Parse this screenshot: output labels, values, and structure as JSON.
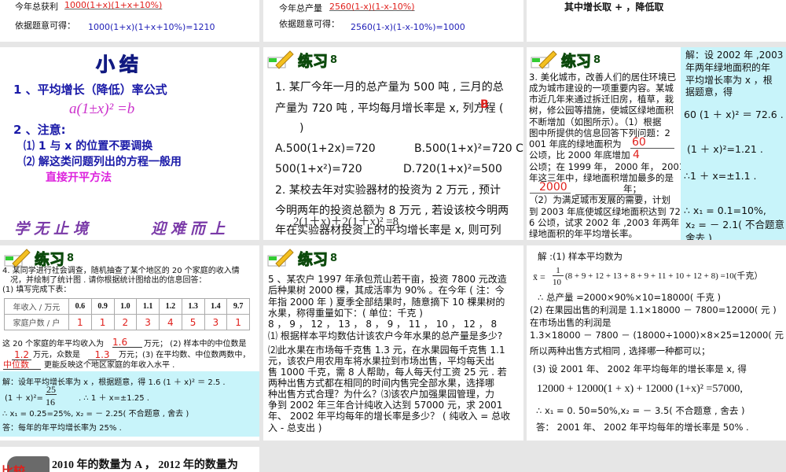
{
  "slides": {
    "s1": {
      "profit_label": "今年总获利",
      "profit_expr": "1000(1+x)(1+x+10%)",
      "basis": "依据题意可得：",
      "equation": "1000(1+x)(1+x+10%)=1210"
    },
    "s2": {
      "output_label": "今年总产量",
      "output_expr": "2560(1-x)(1-x-10%)",
      "basis": "依据题意可得：",
      "equation": "2560(1-x)(1-x-10%)=1000"
    },
    "s3": {
      "text": "其中增长取 + ，降低取"
    },
    "s4": {
      "title": "小结",
      "p1": "1 、平均增长（降低）率公式",
      "formula": "a(1±x)² =b",
      "p2": "2 、注意:",
      "n1": "⑴ 1 与 x 的位置不要调换",
      "n2": "⑵  解这类问题列出的方程一般用",
      "n3": "直接开平方法",
      "motto1": "学无止境",
      "motto2": "迎难而上"
    },
    "s5": {
      "header": "练习",
      "header_num": "8",
      "lines": [
        "1. 某厂今年一月的总产量为 500 吨 , 三月的总",
        "产量为 720 吨 , 平均每月增长率是 x, 列方程 (",
        ")",
        "A.500(1+2x)=720",
        "B.500(1+x)²=720 C.",
        "500(1+x²)=720",
        "D.720(1+x)²=500",
        "2. 某校去年对实验器材的投资为 2 万元 , 预计",
        "今明两年的投资总额为 8 万元 , 若设该校今明两",
        "年在实验器材投资上的平均增长率是 x, 则可列"
      ],
      "answer": "B",
      "overlay": "2(1＋x)＋2(1＋x)² =8"
    },
    "s6": {
      "header": "练习",
      "header_num": "8",
      "lines": [
        "3. 美化城市，改善人们的居住环境已",
        "成为城市建设的一项重要内容。某城",
        "市近几年来通过拆迁旧房，植草，栽",
        "树，修公园等措施，使城区绿地面积",
        "不断增加（如图所示）。（1）根据",
        "图中所提供的信息回答下列问题：2",
        "001 年底的绿地面积为",
        "公顷，比 2000 年底增加",
        "公顷；在 1999 年， 2000 年， 2001",
        "年这三年中，绿地面积增加最多的是",
        "年；",
        "（2）为满足城市发展的需要，计划",
        "到 2003 年底使城区绿地面积达到 72",
        "6 公顷，试求 2002 年 ,2003 年两年",
        "绿地面积的年平均增长率。"
      ],
      "ans1": "60",
      "ans2": "4",
      "ans3": "2000",
      "solution": [
        "解：设 2002 年 ,2003",
        "年两年绿地面积的年",
        "平均增长率为 x ，根",
        "据题意，得",
        "60 (1 ＋ x)² ＝ 72.6  .",
        "(1 ＋ x)²=1.21 .",
        "∴1 ＋ x=±1.1 .",
        "∴ x₁ = 0.1=10%,",
        "x₂ = － 2.1( 不合题意 ,",
        "舍去 )"
      ]
    },
    "s7": {
      "header": "练习",
      "header_num": "8",
      "lines": [
        "4. 某同学进行社会调查，随机抽查了某个地区的 20 个家庭的收入情",
        "况，并绘制了统计图 . 请你根据统计图给出的信息回答：",
        "(1) 填写完成下表："
      ],
      "table": {
        "row1_label": "年收入 / 万元",
        "incomes": [
          "0.6",
          "0.9",
          "1.0",
          "1.1",
          "1.2",
          "1.3",
          "1.4",
          "9.7"
        ],
        "row2_label": "家庭户数 / 户",
        "counts": [
          "1",
          "1",
          "2",
          "3",
          "4",
          "5",
          "3",
          "1"
        ]
      },
      "q_a": "这 20 个家庭的年平均收入为",
      "mean": "1.6",
      "q_b": "万元； (2) 样本中的中位数是",
      "median": "1.2",
      "q_c": "万元，众数是",
      "mode": "1.3",
      "q_d": "万元；(3) 在平均数、中位数两数中，",
      "better": "中位数",
      "q_e": "更能反映这个地区家庭的年收入水平 .",
      "solution": [
        "解：设年平均增长率为 x ，根据题意，得 1.6 (1 ＋ x)² ＝ 2.5 .",
        "(1 ＋ x)²=",
        "25",
        "16",
        ".  ∴ 1 ＋ x=±1.25 .",
        "∴ x₁ = 0.25=25%,  x₂ = － 2.25( 不合题意 , 舍去 )",
        "答：每年的年平均增长率为 25% ."
      ]
    },
    "s8": {
      "header": "练习",
      "header_num": "8",
      "lines": [
        "5 、某农户 1997 年承包荒山若干亩，投资 7800 元改造",
        "后种果树 2000 棵，其成活率为 90% 。在今年 ( 注：今",
        "年指 2000 年 ) 夏季全部结果时，随意摘下 10 棵果树的",
        "水果，称得重量如下：( 单位：千克 )",
        "8 ， 9 ， 12 ， 13 ， 8 ， 9 ， 11 ， 10 ， 12 ， 8",
        "⑴ 根据样本平均数估计该农户今年水果的总产量是多少?",
        "⑵此水果在市场每千克售 1.3 元，在水果园每千克售 1.1",
        "元，该农户用农用车将水果拉到市场出售，平均每天出",
        "售 1000 千克，需 8 人帮助，每人每天付工资 25 元 . 若",
        "两种出售方式都在相同的时间内售完全部水果，选择哪",
        "种出售方式合理？为什么？⑶该农户加强果园管理，力",
        "争到 2002 年三年合计纯收入达到 57000 元，求 2001",
        "年、 2002 年平均每年的增长率是多少？ ( 纯收入 = 总收",
        "入 - 总支出 )"
      ]
    },
    "s9": {
      "lines": [
        "解 :(1) 样本平均数为",
        "x̄ = ",
        "1",
        "10",
        "(8 + 9 + 12 + 13 + 8 + 9 + 11 + 10 + 12 + 8) =10(千克）",
        "∴ 总产量 =2000×90%×10=18000( 千克 )",
        "(2) 在果园出售的利润是 1.1×18000 － 7800=12000( 元 )",
        "在市场出售的利润是",
        "1.3×18000 － 7800 － (18000÷1000)×8×25=12000( 元 )",
        "所以两种出售方式相同 , 选择哪一种都可以；",
        "(3) 设 2001 年、 2002 年平均每年的增长率是 x, 得",
        "12000 + 12000(1 + x) + 12000 (1+x)²  =57000,",
        "∴ x₁ = 0. 50=50%,x₂ = － 3.5( 不合题意 , 舍去 )",
        "答：   2001 年、 2002 年平均每年的增长率是 50% ."
      ]
    },
    "s10": {
      "label": "比较",
      "text": "2010 年的数量为 A ， 2012 年的数量为"
    }
  },
  "colors": {
    "background": "#e6e6e6",
    "answer_red": "#e0201c",
    "blue": "#2222b8",
    "cyan_panel": "#c8f4fa",
    "magenta": "#cc22cc"
  }
}
